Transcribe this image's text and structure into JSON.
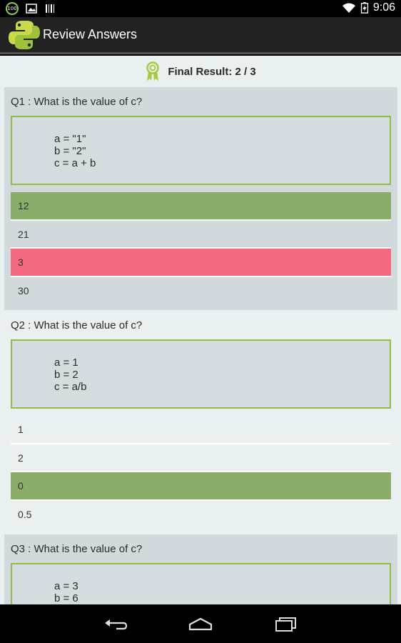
{
  "status_bar": {
    "battery_badge": "100",
    "time": "9:06"
  },
  "app_bar": {
    "title": "Review Answers",
    "logo_icon": "python-logo-icon"
  },
  "result": {
    "icon": "award-ribbon-icon",
    "text": "Final Result: 2 / 3"
  },
  "questions": [
    {
      "title": "Q1 : What is the value of c?",
      "code": [
        "a = \"1\"",
        "b = \"2\"",
        "c = a + b"
      ],
      "options": [
        "12",
        "21",
        "3",
        "30"
      ]
    },
    {
      "title": "Q2 : What is the value of c?",
      "code": [
        "a = 1",
        "b = 2",
        "c = a/b"
      ],
      "options": [
        "1",
        "2",
        "0",
        "0.5"
      ]
    },
    {
      "title": "Q3 : What is the value of c?",
      "code": [
        "a = 3",
        "b = 6"
      ],
      "options": []
    }
  ],
  "colors": {
    "correct": "#8aad6a",
    "wrong": "#f3697f",
    "code_border": "#8fbd45",
    "card_bg": "#d1d9dd",
    "page_bg": "#eaeff0"
  },
  "nav": {
    "back_icon": "back-arrow-icon",
    "home_icon": "home-icon",
    "recents_icon": "recent-apps-icon"
  }
}
